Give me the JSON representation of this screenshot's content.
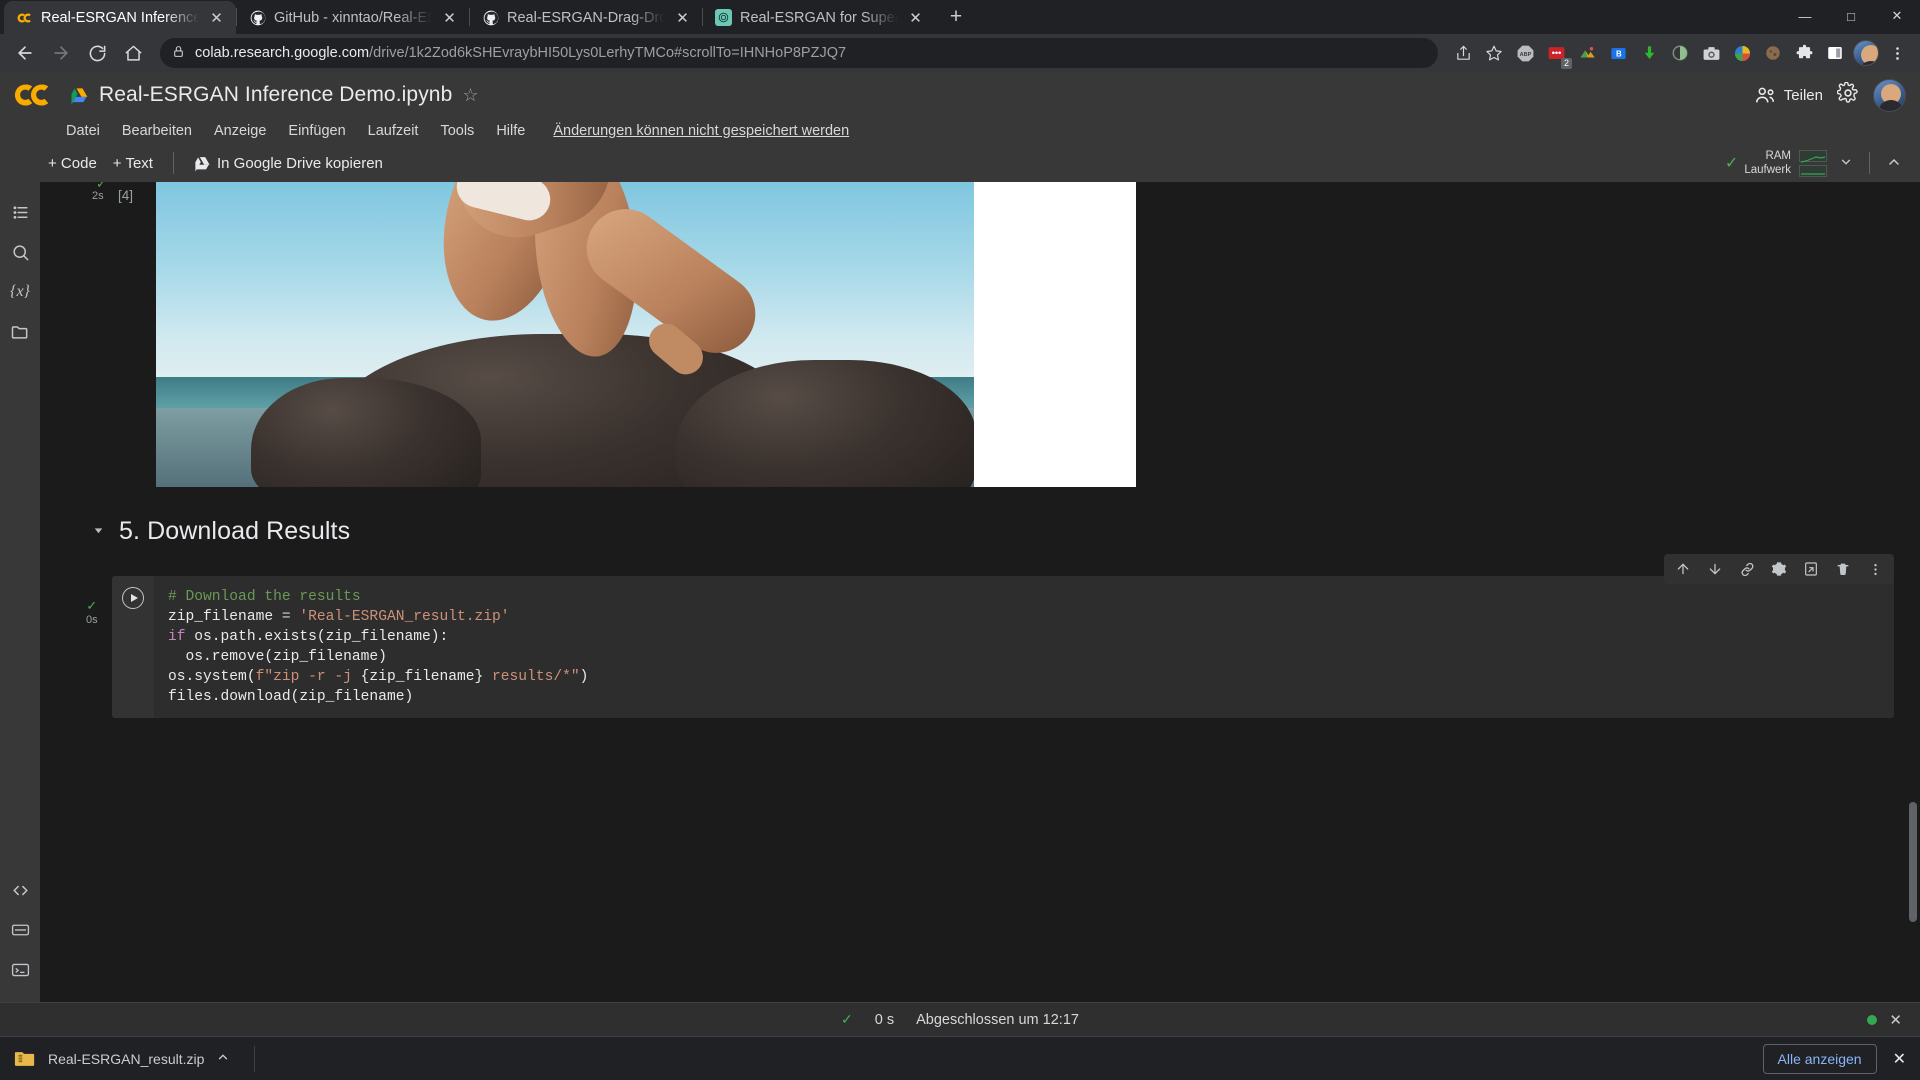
{
  "browser": {
    "tabs": [
      {
        "title": "Real-ESRGAN Inference Demo.ipynb",
        "favicon": "colab-icon",
        "active": true
      },
      {
        "title": "GitHub - xinntao/Real-ESRGAN: ",
        "favicon": "github-icon",
        "active": false
      },
      {
        "title": "Real-ESRGAN-Drag-Drop/drag&",
        "favicon": "github-icon",
        "active": false
      },
      {
        "title": "Real-ESRGAN for Super-Resoluti",
        "favicon": "chatgpt-icon",
        "active": false
      }
    ],
    "new_tab_label": "+",
    "nav": {
      "back": "back-arrow",
      "forward": "forward-arrow",
      "reload": "reload-icon",
      "home": "home-icon"
    },
    "omnibox": {
      "lock": "lock-icon",
      "host": "colab.research.google.com",
      "path": "/drive/1k2Zod6kSHEvraybHI50Lys0LerhyTMCo#scrollTo=IHNHoP8PZJQ7",
      "share": "share-icon",
      "bookmark": "star-icon"
    },
    "extensions": [
      {
        "name": "adblock-plus-icon",
        "badge": ""
      },
      {
        "name": "red-extension-icon",
        "badge": "2"
      },
      {
        "name": "colorful-extension-icon",
        "badge": ""
      },
      {
        "name": "blue-b-extension-icon",
        "badge": ""
      },
      {
        "name": "download-manager-icon",
        "badge": ""
      },
      {
        "name": "dark-circle-extension-icon",
        "badge": ""
      },
      {
        "name": "screenshot-camera-icon",
        "badge": ""
      },
      {
        "name": "sphere-extension-icon",
        "badge": ""
      },
      {
        "name": "brown-circle-extension-icon",
        "badge": ""
      },
      {
        "name": "puzzle-piece-icon",
        "badge": ""
      },
      {
        "name": "sidebar-toggle-icon",
        "badge": ""
      }
    ],
    "profile": "profile-avatar",
    "menu": "kebab-menu-icon",
    "window_controls": {
      "minimize": "—",
      "maximize": "□",
      "close": "✕"
    }
  },
  "colab": {
    "logo": "colab-logo",
    "drive_icon": "drive-icon",
    "notebook_title": "Real-ESRGAN Inference Demo.ipynb",
    "star": "☆",
    "menu_items": [
      "Datei",
      "Bearbeiten",
      "Anzeige",
      "Einfügen",
      "Laufzeit",
      "Tools",
      "Hilfe"
    ],
    "save_status": "Änderungen können nicht gespeichert werden",
    "share_label": "Teilen",
    "settings_icon": "gear-icon",
    "toolbar": {
      "add_code": "+ Code",
      "add_text": "+ Text",
      "copy_to_drive": "In Google Drive kopieren"
    },
    "resources": {
      "check": "✓",
      "ram_label": "RAM",
      "disk_label": "Laufwerk",
      "dropdown": "chevron-down-icon",
      "collapse": "chevron-up-icon"
    },
    "sidebar": [
      {
        "name": "table-of-contents-icon",
        "glyph": "☰"
      },
      {
        "name": "search-icon",
        "glyph": "🔍"
      },
      {
        "name": "variables-icon",
        "glyph": "{x}"
      },
      {
        "name": "files-icon",
        "glyph": "📁"
      },
      {
        "name": "code-snippets-icon",
        "glyph": "<>"
      },
      {
        "name": "command-palette-icon",
        "glyph": "▤"
      },
      {
        "name": "terminal-icon",
        "glyph": ">_"
      }
    ]
  },
  "notebook": {
    "output_cell": {
      "execution_count": "[4]",
      "run_time": "2s",
      "check": "✓",
      "image_alt": "Side-by-side comparison of original and upscaled beach photo"
    },
    "section": {
      "caret": "▾",
      "heading": "5. Download Results"
    },
    "code_cell": {
      "check": "✓",
      "run_time": "0s",
      "run_button": "run-cell-button",
      "toolbar_icons": [
        "move-cell-up-icon",
        "move-cell-down-icon",
        "link-to-cell-icon",
        "cell-settings-icon",
        "open-in-new-tab-icon",
        "delete-cell-icon",
        "more-options-icon"
      ],
      "lines": [
        {
          "parts": [
            {
              "t": "# Download the results",
              "c": "tok-com"
            }
          ]
        },
        {
          "parts": [
            {
              "t": "zip_filename ",
              "c": "tok-var"
            },
            {
              "t": "= ",
              "c": "tok-pun"
            },
            {
              "t": "'Real-ESRGAN_result.zip'",
              "c": "tok-str"
            }
          ]
        },
        {
          "parts": [
            {
              "t": "if ",
              "c": "tok-kw"
            },
            {
              "t": "os.path.exists(zip_filename):",
              "c": "tok-var"
            }
          ]
        },
        {
          "parts": [
            {
              "t": "  os.remove(zip_filename)",
              "c": "tok-var"
            }
          ]
        },
        {
          "parts": [
            {
              "t": "os.system(",
              "c": "tok-var"
            },
            {
              "t": "f\"",
              "c": "tok-str"
            },
            {
              "t": "zip -r -j ",
              "c": "tok-str"
            },
            {
              "t": "{zip_filename}",
              "c": "tok-fstr-in"
            },
            {
              "t": " results/*\"",
              "c": "tok-str"
            },
            {
              "t": ")",
              "c": "tok-var"
            }
          ]
        },
        {
          "parts": [
            {
              "t": "files.download(zip_filename)",
              "c": "tok-var"
            }
          ]
        }
      ]
    }
  },
  "status_bar": {
    "check": "✓",
    "duration": "0 s",
    "completed": "Abgeschlossen um 12:17"
  },
  "download_shelf": {
    "file_icon": "zip-folder-icon",
    "file_name": "Real-ESRGAN_result.zip",
    "expand": "chevron-up-icon",
    "show_all": "Alle anzeigen",
    "close": "✕"
  },
  "colors": {
    "accent_blue": "#8ab4f8",
    "colab_orange": "#f9ab00",
    "success_green": "#34a853",
    "chrome_bg": "#202124",
    "colab_header": "#383838",
    "notebook_bg": "#1b1b1b",
    "code_bg": "#2d2d2d"
  }
}
